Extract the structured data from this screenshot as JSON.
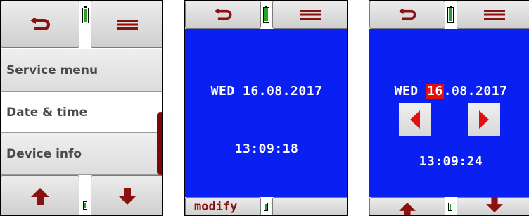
{
  "screen1": {
    "menu_items": [
      "Service menu",
      "Date & time",
      "Device info"
    ],
    "selected_index": 1,
    "icons": [
      "back-icon",
      "menu-icon",
      "arrow-up-icon",
      "arrow-down-icon",
      "battery-icon"
    ]
  },
  "screen2": {
    "date_text": "WED 16.08.2017",
    "time_text": "13:09:18",
    "soft_key_label": "modify"
  },
  "screen3": {
    "date_prefix": "WED ",
    "date_highlight": "16",
    "date_suffix": ".08.2017",
    "time_text": "13:09:24"
  },
  "colors": {
    "accent": "#8b1010",
    "screen_blue": "#0a1ff2",
    "highlight": "#e01010",
    "battery": "#1fa81f"
  }
}
